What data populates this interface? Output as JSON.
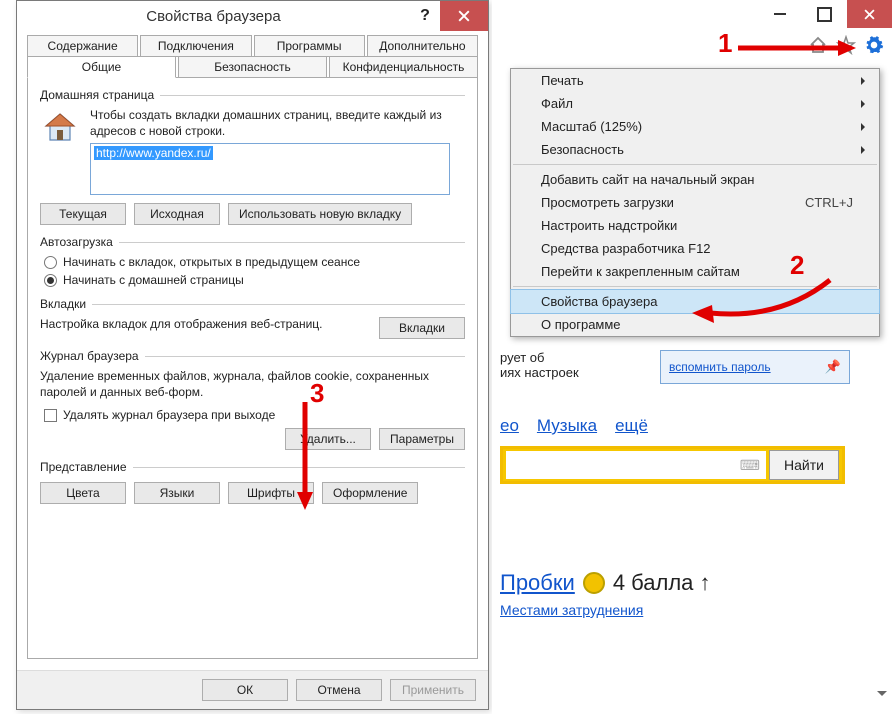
{
  "dialog": {
    "title": "Свойства браузера",
    "tabs_row1": [
      "Содержание",
      "Подключения",
      "Программы",
      "Дополнительно"
    ],
    "tabs_row2": [
      "Общие",
      "Безопасность",
      "Конфиденциальность"
    ],
    "active_tab": "Общие",
    "home": {
      "group": "Домашняя страница",
      "desc": "Чтобы создать вкладки домашних страниц, введите каждый из адресов с новой строки.",
      "url": "http://www.yandex.ru/",
      "btn_current": "Текущая",
      "btn_default": "Исходная",
      "btn_newtab": "Использовать новую вкладку"
    },
    "startup": {
      "group": "Автозагрузка",
      "opt_tabs": "Начинать с вкладок, открытых в предыдущем сеансе",
      "opt_home": "Начинать с домашней страницы",
      "selected": "opt_home"
    },
    "tabs": {
      "group": "Вкладки",
      "desc": "Настройка вкладок для отображения веб-страниц.",
      "btn": "Вкладки"
    },
    "history": {
      "group": "Журнал браузера",
      "desc": "Удаление временных файлов, журнала, файлов cookie, сохраненных паролей и данных веб-форм.",
      "chk": "Удалять журнал браузера при выходе",
      "btn_delete": "Удалить...",
      "btn_settings": "Параметры"
    },
    "appearance": {
      "group": "Представление",
      "btn_colors": "Цвета",
      "btn_langs": "Языки",
      "btn_fonts": "Шрифты",
      "btn_access": "Оформление"
    },
    "footer": {
      "ok": "ОК",
      "cancel": "Отмена",
      "apply": "Применить"
    }
  },
  "menu": {
    "print": "Печать",
    "file": "Файл",
    "zoom": "Масштаб (125%)",
    "safety": "Безопасность",
    "add_start": "Добавить сайт на начальный экран",
    "downloads": "Просмотреть загрузки",
    "downloads_shortcut": "CTRL+J",
    "addons": "Настроить надстройки",
    "f12": "Средства разработчика F12",
    "pinned": "Перейти к закрепленным сайтам",
    "options": "Свойства браузера",
    "about": "О программе"
  },
  "page": {
    "frag_top_left": "рует об",
    "frag_top_left2": "иях настроек",
    "remember_pw": "вспомнить пароль",
    "tabs": {
      "video": "ео",
      "music": "Музыка",
      "more": "ещё"
    },
    "search_btn": "Найти",
    "traffic_label": "Пробки",
    "traffic_value": "4 балла ↑",
    "traffic_sub": "Местами затруднения"
  },
  "annotations": {
    "n1": "1",
    "n2": "2",
    "n3": "3"
  }
}
